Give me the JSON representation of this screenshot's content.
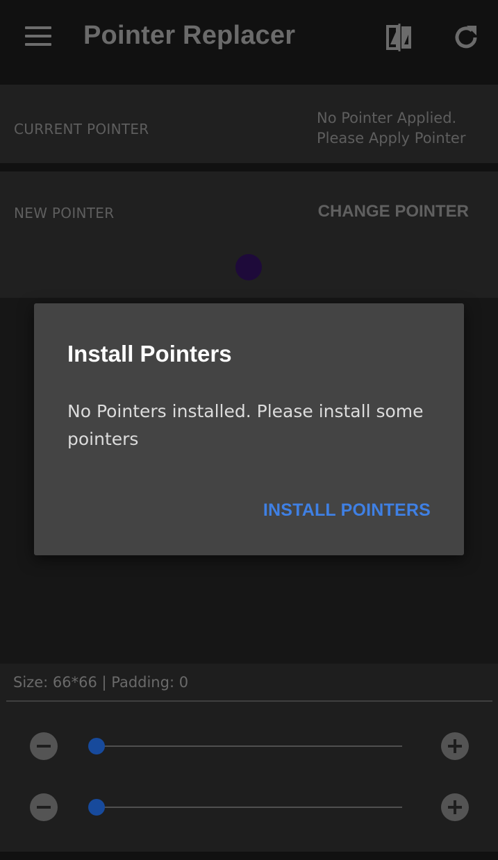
{
  "appbar": {
    "title": "Pointer Replacer",
    "icons": [
      "menu-icon",
      "compare-icon",
      "refresh-icon"
    ]
  },
  "current_pointer": {
    "label": "CURRENT POINTER",
    "status_line1": "No Pointer Applied.",
    "status_line2": "Please Apply Pointer"
  },
  "new_pointer": {
    "label": "NEW POINTER",
    "change_label": "CHANGE POINTER",
    "preview_color": "#1e0a3a"
  },
  "dialog": {
    "title": "Install Pointers",
    "message": "No Pointers installed. Please install some pointers",
    "action_label": "INSTALL POINTERS",
    "action_color": "#3f80e4"
  },
  "controls": {
    "size_text": "Size: 66*66 | Padding: 0",
    "size_slider_value": 0,
    "padding_slider_value": 0,
    "thumb_color": "#174a9c"
  }
}
